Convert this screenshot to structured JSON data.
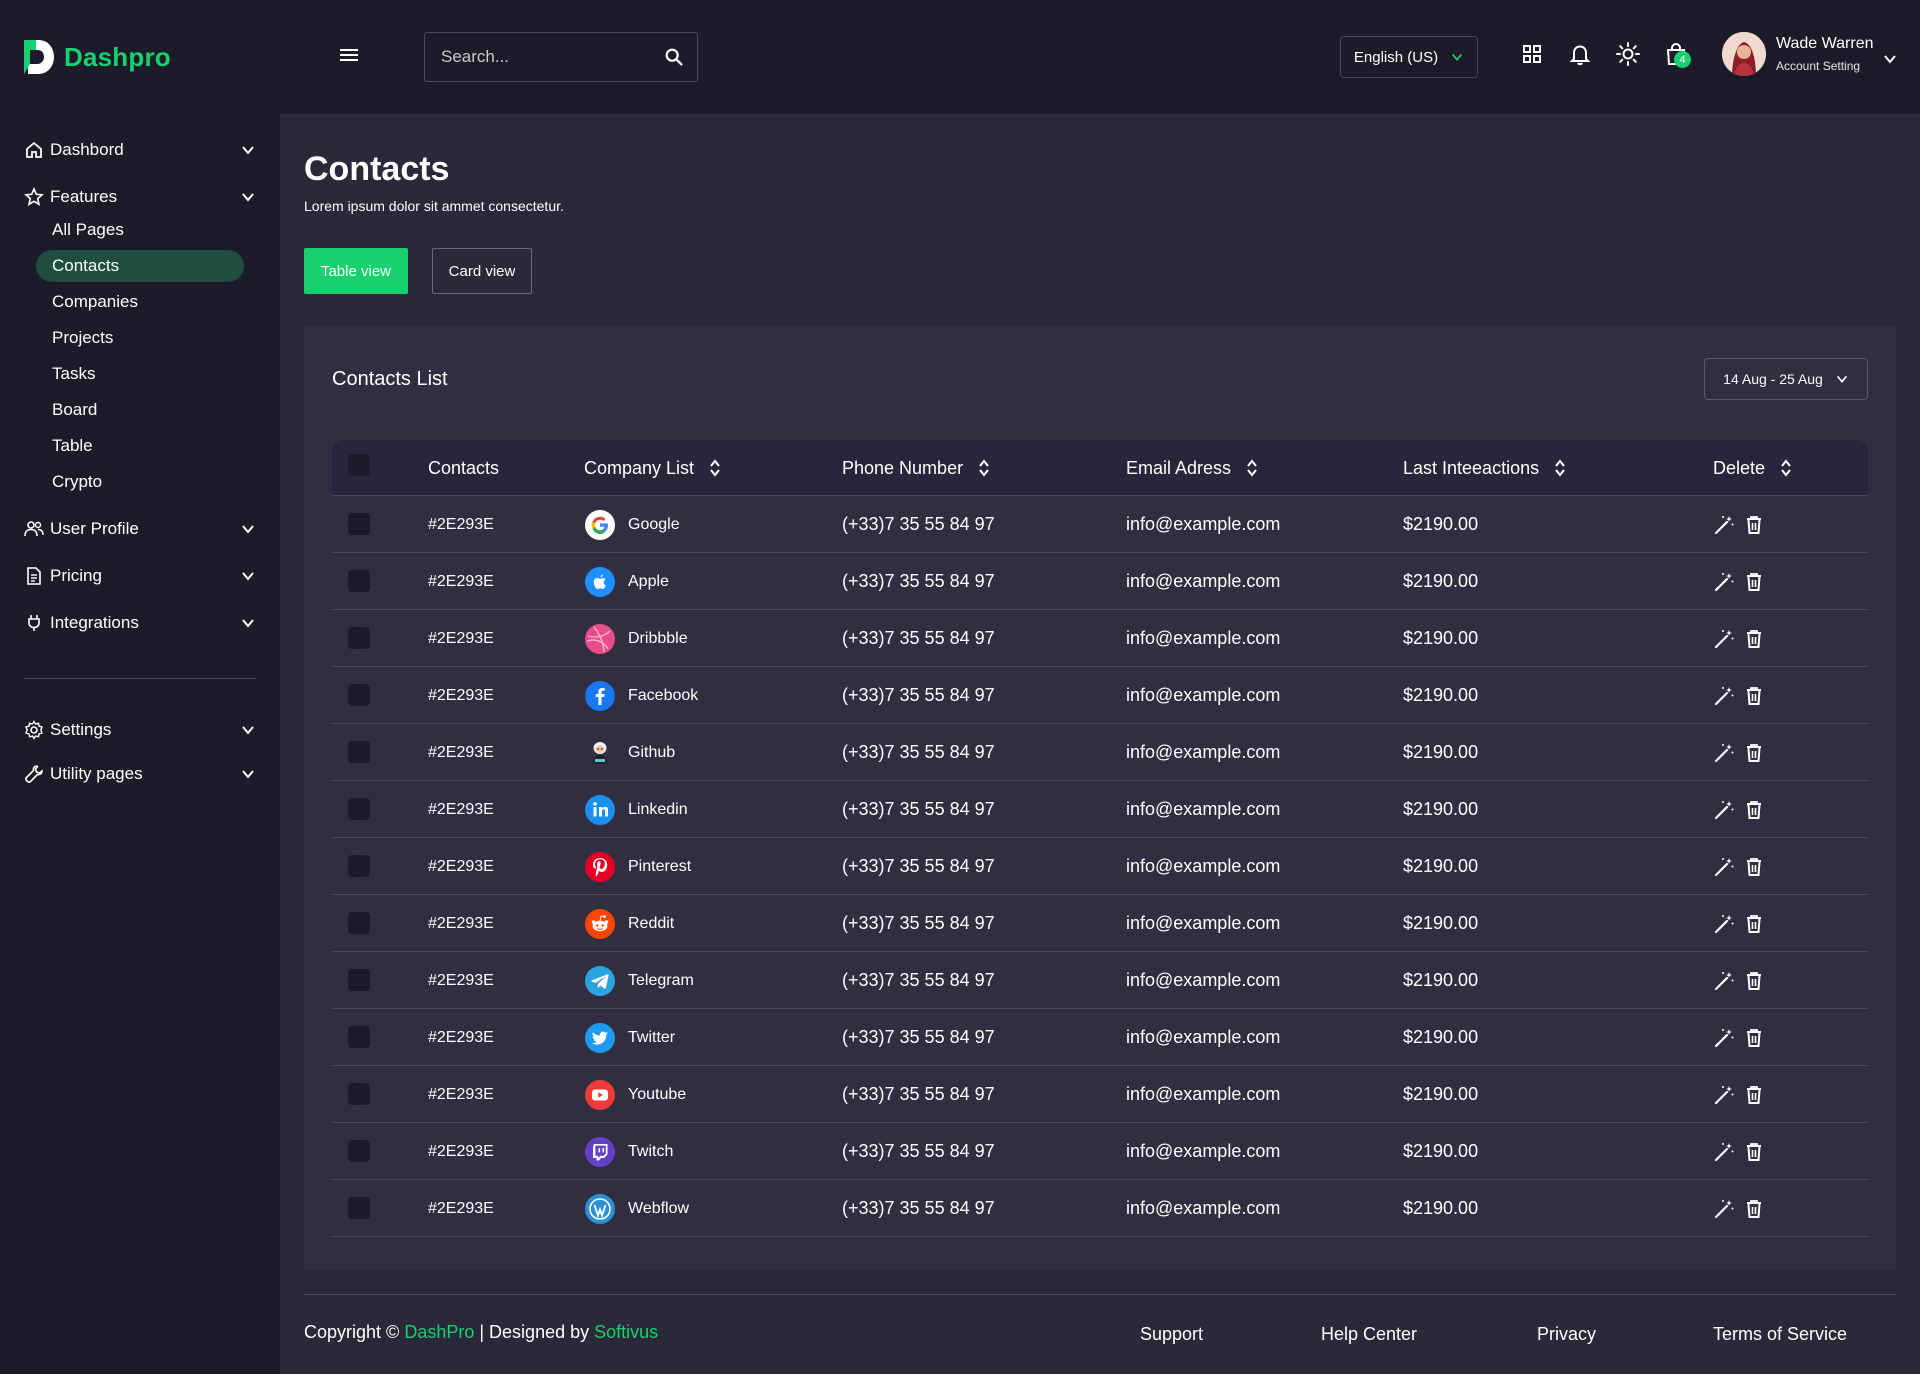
{
  "brand": {
    "name": "Dashpro",
    "accent": "#17d16f"
  },
  "header": {
    "search_placeholder": "Search...",
    "language": "English (US)",
    "cart_count": "4",
    "user_name": "Wade Warren",
    "user_sub": "Account Setting"
  },
  "sidebar": {
    "groups": [
      {
        "label": "Dashbord",
        "icon": "home-icon"
      },
      {
        "label": "Features",
        "icon": "star-icon"
      },
      {
        "label": "User Profile",
        "icon": "users-icon"
      },
      {
        "label": "Pricing",
        "icon": "document-icon"
      },
      {
        "label": "Integrations",
        "icon": "plug-icon"
      },
      {
        "label": "Settings",
        "icon": "gear-icon"
      },
      {
        "label": "Utility pages",
        "icon": "wrench-icon"
      }
    ],
    "feature_items": [
      "All Pages",
      "Contacts",
      "Companies",
      "Projects",
      "Tasks",
      "Board",
      "Table",
      "Crypto"
    ]
  },
  "page": {
    "title": "Contacts",
    "subtitle": "Lorem ipsum dolor sit ammet consectetur.",
    "table_view": "Table view",
    "card_view": "Card view"
  },
  "panel": {
    "title": "Contacts List",
    "date_range": "14 Aug - 25 Aug",
    "columns": [
      "Contacts",
      "Company List",
      "Phone Number",
      "Email Adress",
      "Last Inteeactions",
      "Delete"
    ],
    "rows": [
      {
        "contact": "#2E293E",
        "company": "Google",
        "icon": "google-icon",
        "color": "#ffffff",
        "phone": "(+33)7 35 55 84 97",
        "email": "info@example.com",
        "amount": "$2190.00"
      },
      {
        "contact": "#2E293E",
        "company": "Apple",
        "icon": "apple-icon",
        "color": "#1e90ff",
        "phone": "(+33)7 35 55 84 97",
        "email": "info@example.com",
        "amount": "$2190.00"
      },
      {
        "contact": "#2E293E",
        "company": "Dribbble",
        "icon": "dribbble-icon",
        "color": "#ea4c89",
        "phone": "(+33)7 35 55 84 97",
        "email": "info@example.com",
        "amount": "$2190.00"
      },
      {
        "contact": "#2E293E",
        "company": "Facebook",
        "icon": "facebook-icon",
        "color": "#1877f2",
        "phone": "(+33)7 35 55 84 97",
        "email": "info@example.com",
        "amount": "$2190.00"
      },
      {
        "contact": "#2E293E",
        "company": "Github",
        "icon": "github-icon",
        "color": "#302e40",
        "phone": "(+33)7 35 55 84 97",
        "email": "info@example.com",
        "amount": "$2190.00"
      },
      {
        "contact": "#2E293E",
        "company": "Linkedin",
        "icon": "linkedin-icon",
        "color": "#1a8ff0",
        "phone": "(+33)7 35 55 84 97",
        "email": "info@example.com",
        "amount": "$2190.00"
      },
      {
        "contact": "#2E293E",
        "company": "Pinterest",
        "icon": "pinterest-icon",
        "color": "#e60023",
        "phone": "(+33)7 35 55 84 97",
        "email": "info@example.com",
        "amount": "$2190.00"
      },
      {
        "contact": "#2E293E",
        "company": "Reddit",
        "icon": "reddit-icon",
        "color": "#ff4500",
        "phone": "(+33)7 35 55 84 97",
        "email": "info@example.com",
        "amount": "$2190.00"
      },
      {
        "contact": "#2E293E",
        "company": "Telegram",
        "icon": "telegram-icon",
        "color": "#2aa3e0",
        "phone": "(+33)7 35 55 84 97",
        "email": "info@example.com",
        "amount": "$2190.00"
      },
      {
        "contact": "#2E293E",
        "company": "Twitter",
        "icon": "twitter-icon",
        "color": "#1d9bf0",
        "phone": "(+33)7 35 55 84 97",
        "email": "info@example.com",
        "amount": "$2190.00"
      },
      {
        "contact": "#2E293E",
        "company": "Youtube",
        "icon": "youtube-icon",
        "color": "#ee3b3b",
        "phone": "(+33)7 35 55 84 97",
        "email": "info@example.com",
        "amount": "$2190.00"
      },
      {
        "contact": "#2E293E",
        "company": "Twitch",
        "icon": "twitch-icon",
        "color": "#6441c8",
        "phone": "(+33)7 35 55 84 97",
        "email": "info@example.com",
        "amount": "$2190.00"
      },
      {
        "contact": "#2E293E",
        "company": "Webflow",
        "icon": "wordpress-icon",
        "color": "#2b8fd3",
        "phone": "(+33)7 35 55 84 97",
        "email": "info@example.com",
        "amount": "$2190.00"
      }
    ]
  },
  "footer": {
    "copyright": "Copyright ©",
    "brand": "DashPro",
    "designed_by": "| Designed by",
    "designer": "Softivus",
    "links": [
      "Support",
      "Help Center",
      "Privacy",
      "Terms of Service"
    ]
  }
}
